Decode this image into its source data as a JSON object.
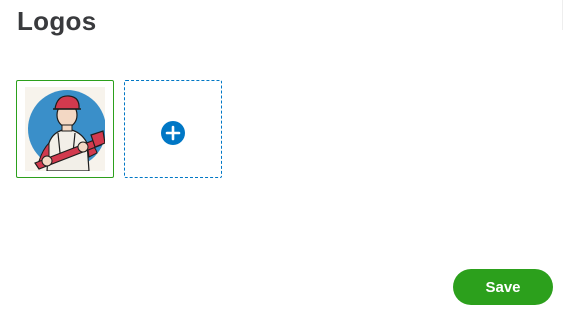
{
  "header": {
    "title": "Logos"
  },
  "logos": {
    "items": [
      {
        "icon": "plumber-logo",
        "selected": true
      }
    ],
    "add_icon": "plus-circle-icon"
  },
  "actions": {
    "save_label": "Save"
  },
  "colors": {
    "accent_green": "#2ca01c",
    "accent_blue": "#0077c5",
    "title_text": "#393a3d"
  }
}
